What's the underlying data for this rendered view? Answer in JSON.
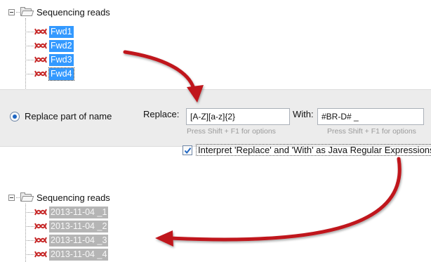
{
  "top_tree": {
    "root_label": "Sequencing reads",
    "items": [
      {
        "label": "Fwd1"
      },
      {
        "label": "Fwd2"
      },
      {
        "label": "Fwd3"
      },
      {
        "label": "Fwd4"
      }
    ],
    "selection_color": "#3399ff"
  },
  "options": {
    "mode_label": "Replace part of name",
    "replace_label": "Replace:",
    "replace_value": "[A-Z][a-z]{2}",
    "replace_hint": "Press Shift + F1 for options",
    "with_label": "With:",
    "with_value": "#BR-D# _",
    "with_hint": "Press Shift + F1 for options",
    "regex_label": "Interpret 'Replace' and 'With' as Java Regular Expressions",
    "regex_checked": true
  },
  "bottom_tree": {
    "root_label": "Sequencing reads",
    "items": [
      {
        "label": "2013-11-04 _1"
      },
      {
        "label": "2013-11-04 _2"
      },
      {
        "label": "2013-11-04 _3"
      },
      {
        "label": "2013-11-04 _4"
      }
    ],
    "selection_color": "#b5b5b5"
  },
  "colors": {
    "arrow": "#c0191e",
    "sequence_icon": "#c62828",
    "panel_background": "#ececec"
  },
  "icons": {
    "expander": "minus-expander-icon",
    "folder": "folder-icon",
    "sequence": "sequence-read-icon"
  }
}
